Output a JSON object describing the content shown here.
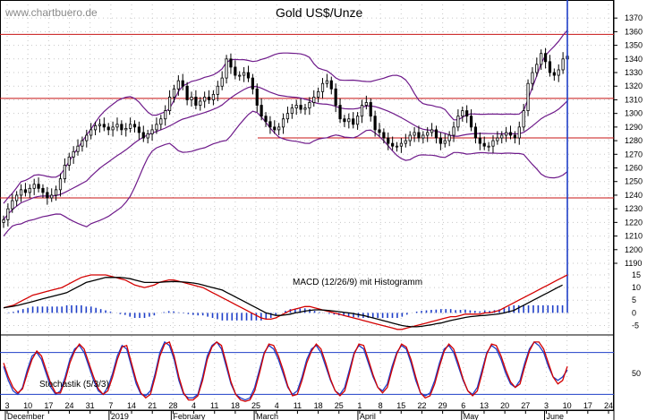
{
  "site": "www.chartbuero.de",
  "chart_data": [
    {
      "type": "candlestick",
      "title": "Gold US$/Unze",
      "ylim": [
        1190,
        1378
      ],
      "y_ticks": [
        1190,
        1200,
        1210,
        1220,
        1230,
        1240,
        1250,
        1260,
        1270,
        1280,
        1290,
        1300,
        1310,
        1320,
        1330,
        1340,
        1350,
        1360,
        1370
      ],
      "grid": true,
      "horizontal_lines": [
        1358,
        1311,
        1282,
        1238
      ],
      "close": [
        1222,
        1230,
        1236,
        1240,
        1244,
        1242,
        1245,
        1248,
        1245,
        1242,
        1238,
        1240,
        1244,
        1252,
        1262,
        1268,
        1272,
        1276,
        1280,
        1284,
        1288,
        1291,
        1292,
        1290,
        1288,
        1290,
        1292,
        1288,
        1289,
        1292,
        1290,
        1286,
        1282,
        1285,
        1288,
        1292,
        1296,
        1302,
        1312,
        1318,
        1324,
        1320,
        1310,
        1312,
        1306,
        1309,
        1312,
        1310,
        1314,
        1320,
        1326,
        1340,
        1334,
        1328,
        1328,
        1330,
        1326,
        1318,
        1306,
        1298,
        1294,
        1290,
        1288,
        1290,
        1296,
        1300,
        1304,
        1306,
        1303,
        1304,
        1308,
        1312,
        1316,
        1322,
        1324,
        1318,
        1306,
        1296,
        1294,
        1296,
        1292,
        1298,
        1306,
        1308,
        1298,
        1288,
        1286,
        1282,
        1278,
        1276,
        1276,
        1278,
        1280,
        1284,
        1286,
        1282,
        1284,
        1286,
        1288,
        1282,
        1278,
        1280,
        1284,
        1290,
        1298,
        1302,
        1298,
        1290,
        1282,
        1278,
        1276,
        1276,
        1280,
        1282,
        1284,
        1286,
        1284,
        1282,
        1290,
        1302,
        1322,
        1330,
        1336,
        1344,
        1338,
        1330,
        1328,
        1332,
        1340,
        1342
      ]
    },
    {
      "type": "line",
      "title": "MACD (12/26/9) mit Histogramm",
      "ylim": [
        -8,
        21
      ],
      "y_ticks": [
        -5,
        0,
        5,
        10,
        15
      ],
      "grid": true,
      "series": [
        {
          "color": "#d40000",
          "values": [
            2,
            2.5,
            3,
            4,
            5,
            6,
            7,
            7.5,
            8,
            8.5,
            9,
            9.5,
            10,
            11,
            12,
            13,
            14,
            14.5,
            15,
            15,
            15,
            15,
            14.5,
            14,
            13.5,
            13,
            12,
            11,
            10.5,
            10,
            10.5,
            11,
            12,
            12.5,
            13,
            13,
            12.5,
            12,
            11.5,
            11,
            10.5,
            10,
            9,
            8,
            7,
            6,
            5,
            4,
            3,
            2,
            1,
            0,
            -1,
            -2,
            -2.5,
            -2.5,
            -2,
            -1,
            0,
            1,
            1.5,
            2,
            2.5,
            2.5,
            2,
            1.5,
            1,
            0.5,
            0,
            -0.5,
            -1,
            -1.5,
            -2,
            -2.5,
            -3,
            -3.5,
            -4,
            -4.5,
            -5,
            -5.5,
            -6,
            -6.5,
            -6.5,
            -6,
            -5.5,
            -5,
            -4.5,
            -4,
            -3.5,
            -3,
            -2.5,
            -2,
            -1.5,
            -1.5,
            -1,
            -0.5,
            -0.5,
            -0.5,
            -0.5,
            0,
            0,
            0.5,
            1,
            2,
            3,
            4,
            5,
            6,
            7,
            8,
            9,
            10,
            11,
            12,
            13,
            14,
            15
          ]
        },
        {
          "color": "#000000",
          "values": [
            2,
            2.3,
            2.6,
            3,
            3.5,
            4,
            4.5,
            5,
            5.5,
            6,
            6.5,
            7,
            7.5,
            8,
            9,
            10,
            11,
            12,
            12.5,
            13,
            13.5,
            14,
            14,
            14,
            14,
            13.8,
            13.5,
            13,
            12.5,
            12,
            12,
            12,
            12,
            12.2,
            12.3,
            12.4,
            12.3,
            12.2,
            12,
            11.8,
            11.5,
            11,
            10.5,
            10,
            9.5,
            9,
            8,
            7,
            6,
            5,
            4,
            3,
            2,
            1,
            0,
            -0.5,
            -1,
            -1,
            -0.8,
            -0.5,
            0,
            0.3,
            0.7,
            1,
            1.2,
            1.2,
            1.1,
            0.9,
            0.7,
            0.5,
            0.2,
            0,
            -0.3,
            -0.7,
            -1,
            -1.5,
            -2,
            -2.5,
            -3,
            -3.5,
            -4,
            -4.5,
            -5,
            -5.3,
            -5.5,
            -5.5,
            -5.3,
            -5,
            -4.7,
            -4.3,
            -4,
            -3.5,
            -3,
            -2.6,
            -2.2,
            -1.8,
            -1.5,
            -1.3,
            -1.1,
            -1,
            -0.8,
            -0.6,
            -0.4,
            0,
            0.5,
            1,
            2,
            3,
            4,
            5,
            6,
            7,
            8,
            9,
            10,
            11
          ]
        }
      ]
    },
    {
      "type": "line",
      "title": "Stochastik (5/3/3)",
      "ylim": [
        0,
        100
      ],
      "y_ticks": [
        50
      ],
      "reference_lines": [
        80,
        20
      ],
      "grid": true,
      "series": [
        {
          "color": "#1f3fc8",
          "values": [
            60,
            40,
            25,
            20,
            30,
            55,
            75,
            80,
            70,
            50,
            30,
            20,
            25,
            45,
            70,
            85,
            90,
            80,
            60,
            40,
            25,
            20,
            30,
            50,
            75,
            90,
            85,
            60,
            35,
            20,
            18,
            25,
            50,
            80,
            95,
            90,
            70,
            40,
            20,
            15,
            15,
            20,
            45,
            75,
            90,
            95,
            85,
            60,
            35,
            20,
            15,
            12,
            15,
            30,
            55,
            80,
            90,
            85,
            70,
            50,
            30,
            20,
            25,
            45,
            70,
            85,
            90,
            80,
            60,
            40,
            25,
            20,
            30,
            55,
            80,
            90,
            85,
            65,
            45,
            30,
            25,
            35,
            60,
            80,
            90,
            85,
            65,
            40,
            22,
            18,
            22,
            40,
            65,
            85,
            90,
            80,
            60,
            40,
            25,
            20,
            30,
            55,
            80,
            90,
            85,
            70,
            50,
            35,
            30,
            40,
            65,
            85,
            95,
            90,
            80,
            60,
            45,
            40,
            45,
            55
          ]
        },
        {
          "color": "#d40000",
          "values": [
            65,
            45,
            30,
            22,
            28,
            50,
            70,
            82,
            75,
            55,
            35,
            22,
            22,
            40,
            65,
            82,
            92,
            85,
            65,
            45,
            28,
            20,
            25,
            45,
            70,
            88,
            90,
            65,
            40,
            22,
            15,
            20,
            45,
            75,
            92,
            95,
            75,
            45,
            22,
            12,
            12,
            18,
            40,
            70,
            88,
            95,
            90,
            65,
            38,
            20,
            12,
            10,
            12,
            25,
            50,
            78,
            92,
            90,
            75,
            55,
            32,
            18,
            20,
            40,
            65,
            82,
            92,
            85,
            65,
            42,
            25,
            18,
            25,
            50,
            78,
            92,
            90,
            70,
            48,
            30,
            22,
            30,
            55,
            78,
            92,
            88,
            70,
            45,
            22,
            15,
            18,
            35,
            60,
            82,
            92,
            85,
            65,
            42,
            25,
            18,
            25,
            50,
            78,
            92,
            90,
            75,
            55,
            38,
            30,
            35,
            60,
            82,
            95,
            95,
            85,
            65,
            45,
            35,
            40,
            60
          ]
        }
      ]
    }
  ],
  "x_axis": {
    "day_ticks": [
      "3",
      "10",
      "17",
      "24",
      "31",
      "7",
      "14",
      "21",
      "28",
      "4",
      "11",
      "18",
      "25",
      "4",
      "11",
      "18",
      "25",
      "1",
      "8",
      "15",
      "22",
      "29",
      "6",
      "13",
      "20",
      "27",
      "3",
      "10",
      "17",
      "24"
    ],
    "month_labels": [
      "December",
      "2019",
      "February",
      "March",
      "April",
      "May",
      "June"
    ]
  }
}
